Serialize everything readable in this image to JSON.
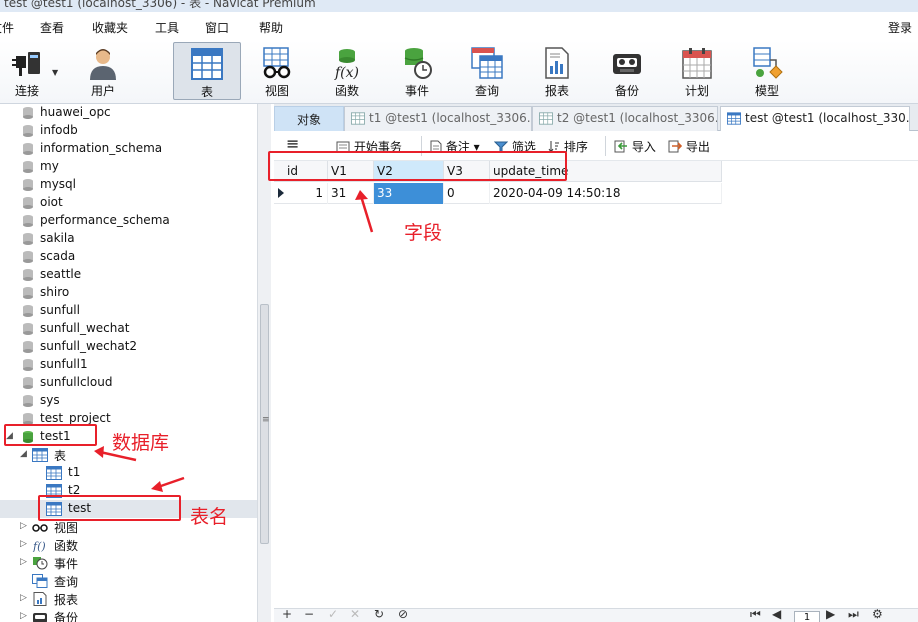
{
  "window": {
    "title": "test @test1 (localhost_3306) - 表 - Navicat Premium"
  },
  "menu": {
    "items": [
      "文件",
      "查看",
      "收藏夹",
      "工具",
      "窗口",
      "帮助"
    ],
    "login": "登录"
  },
  "toolbar": {
    "buttons": [
      {
        "label": "连接",
        "icon": "connection-plug-icon"
      },
      {
        "label": "用户",
        "icon": "user-icon"
      },
      {
        "label": "表",
        "icon": "table-icon",
        "active": true
      },
      {
        "label": "视图",
        "icon": "view-glasses-icon"
      },
      {
        "label": "函数",
        "icon": "function-icon"
      },
      {
        "label": "事件",
        "icon": "event-clock-icon"
      },
      {
        "label": "查询",
        "icon": "query-icon"
      },
      {
        "label": "报表",
        "icon": "report-icon"
      },
      {
        "label": "备份",
        "icon": "backup-icon"
      },
      {
        "label": "计划",
        "icon": "schedule-calendar-icon"
      },
      {
        "label": "模型",
        "icon": "model-icon"
      }
    ]
  },
  "tree": {
    "databases": [
      "huawei_opc",
      "infodb",
      "information_schema",
      "my",
      "mysql",
      "oiot",
      "performance_schema",
      "sakila",
      "scada",
      "seattle",
      "shiro",
      "sunfull",
      "sunfull_wechat",
      "sunfull_wechat2",
      "sunfull1",
      "sunfullcloud",
      "sys",
      "test_project"
    ],
    "open_db": "test1",
    "tables_node": "表",
    "tables": [
      "t1",
      "t2",
      "test"
    ],
    "selected_table": "test",
    "other_nodes": [
      "视图",
      "函数",
      "事件",
      "查询",
      "报表",
      "备份"
    ]
  },
  "tabs": {
    "objects": "对象",
    "items": [
      {
        "label": "t1 @test1 (localhost_3306..."
      },
      {
        "label": "t2 @test1 (localhost_3306..."
      },
      {
        "label": "test @test1 (localhost_330..."
      }
    ]
  },
  "subtoolbar": {
    "menu_icon": "hamburger-menu-icon",
    "begin_transaction": "开始事务",
    "note": "备注",
    "filter": "筛选",
    "sort": "排序",
    "import": "导入",
    "export": "导出"
  },
  "grid": {
    "columns": [
      "id",
      "V1",
      "V2",
      "V3",
      "update_time"
    ],
    "highlighted_column": "V2",
    "rows": [
      [
        "1",
        "31",
        "33",
        "0",
        "2020-04-09 14:50:18"
      ]
    ]
  },
  "annotations": {
    "fields": "字段",
    "database": "数据库",
    "table_name": "表名",
    "color": "#e8202a"
  },
  "pager": {
    "page": "1"
  }
}
